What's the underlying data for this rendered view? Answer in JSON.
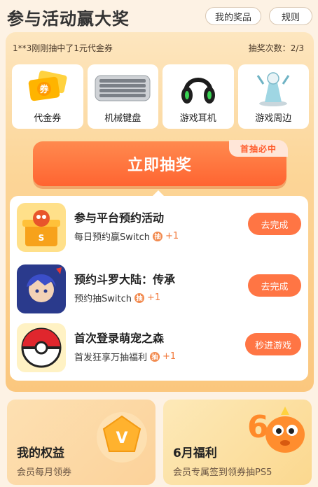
{
  "header": {
    "title": "参与活动赢大奖",
    "my_prizes": "我的奖品",
    "rules": "规则"
  },
  "ticker": {
    "text": "1**3刚刚抽中了1元代金券",
    "draw_count_label": "抽奖次数：",
    "draw_count_value": "2/3"
  },
  "prizes": [
    {
      "label": "代金券",
      "icon": "voucher-icon"
    },
    {
      "label": "机械键盘",
      "icon": "keyboard-icon"
    },
    {
      "label": "游戏耳机",
      "icon": "headset-icon"
    },
    {
      "label": "游戏周边",
      "icon": "figurine-icon"
    }
  ],
  "draw": {
    "label": "立即抽奖",
    "badge": "首抽必中"
  },
  "tasks": [
    {
      "title": "参与平台预约活动",
      "subtitle": "每日预约赢Switch",
      "reward": "+1",
      "button": "去完成",
      "icon": "gift-box-icon"
    },
    {
      "title": "预约斗罗大陆：传承",
      "subtitle": "预约抽Switch",
      "reward": "+1",
      "button": "去完成",
      "icon": "game-character-icon"
    },
    {
      "title": "首次登录萌宠之森",
      "subtitle": "首发狂享万抽福利",
      "reward": "+1",
      "button": "秒进游戏",
      "icon": "pokeball-icon"
    }
  ],
  "cards": [
    {
      "title": "我的权益",
      "subtitle": "会员每月领券",
      "icon": "diamond-v-icon"
    },
    {
      "title": "6月福利",
      "subtitle": "会员专属签到领券抽PS5",
      "icon": "june-mascot-icon"
    }
  ],
  "colors": {
    "accent": "#ff6a35",
    "panel": "#fcd597",
    "background": "#fdf2e4"
  }
}
